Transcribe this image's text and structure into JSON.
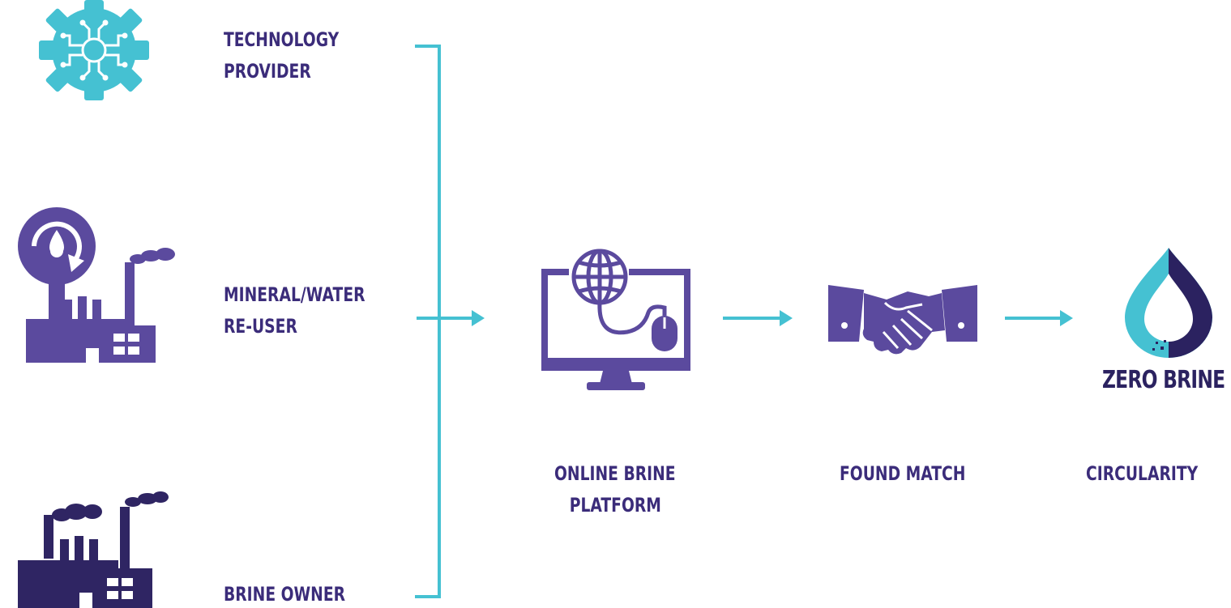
{
  "colors": {
    "accent": "#45c1d2",
    "primary": "#5b4a9e",
    "dark": "#2f2563",
    "text": "#3b2c7a"
  },
  "inputs": [
    {
      "line1": "TECHNOLOGY",
      "line2": "PROVIDER",
      "icon": "gear-circuit-icon"
    },
    {
      "line1": "MINERAL/WATER",
      "line2": "RE-USER",
      "icon": "factory-recycle-icon"
    },
    {
      "line1": "BRINE OWNER",
      "line2": "",
      "icon": "factory-icon"
    }
  ],
  "steps": [
    {
      "line1": "ONLINE BRINE",
      "line2": "PLATFORM",
      "icon": "computer-globe-icon"
    },
    {
      "line1": "FOUND MATCH",
      "line2": "",
      "icon": "handshake-icon"
    },
    {
      "line1": "CIRCULARITY",
      "line2": "",
      "icon": "drop-logo-icon"
    }
  ],
  "logo": {
    "text": "ZERO BRINE"
  }
}
